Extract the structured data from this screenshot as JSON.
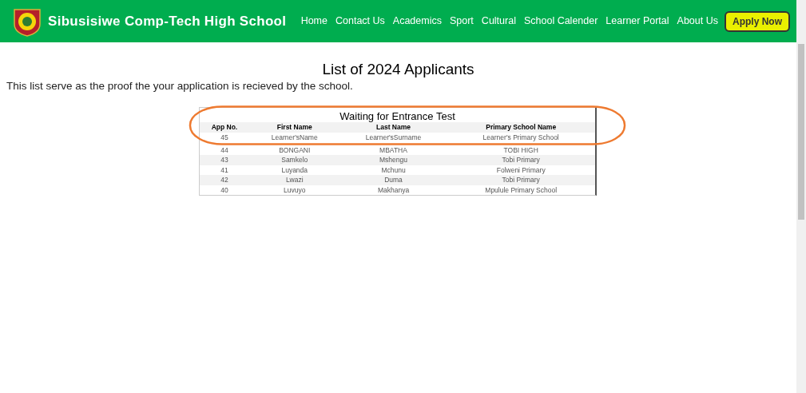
{
  "header": {
    "site_title": "Sibusisiwe Comp-Tech High School",
    "nav": [
      {
        "label": "Home"
      },
      {
        "label": "Contact Us"
      },
      {
        "label": "Academics"
      },
      {
        "label": "Sport"
      },
      {
        "label": "Cultural"
      },
      {
        "label": "School Calender"
      },
      {
        "label": "Learner Portal"
      },
      {
        "label": "About Us"
      }
    ],
    "cta": "Apply Now"
  },
  "heading": "List of 2024 Applicants",
  "intro": "This list serve as the proof the your application is recieved by the school.",
  "table": {
    "caption": "Waiting for Entrance Test",
    "columns": [
      "App No.",
      "First Name",
      "Last Name",
      "Primary School Name"
    ],
    "rows": [
      [
        "45",
        "Learner'sName",
        "Learner'sSurname",
        "Learner's Primary School"
      ],
      [
        "44",
        "BONGANI",
        "MBATHA",
        "TOBI HIGH"
      ],
      [
        "43",
        "Samkelo",
        "Mshengu",
        "Tobi Primary"
      ],
      [
        "41",
        "Luyanda",
        "Mchunu",
        "Folweni Primary"
      ],
      [
        "42",
        "Lwazi",
        "Duma",
        "Tobi Primary"
      ],
      [
        "40",
        "Luvuyo",
        "Makhanya",
        "Mpulule Primary School"
      ]
    ]
  }
}
